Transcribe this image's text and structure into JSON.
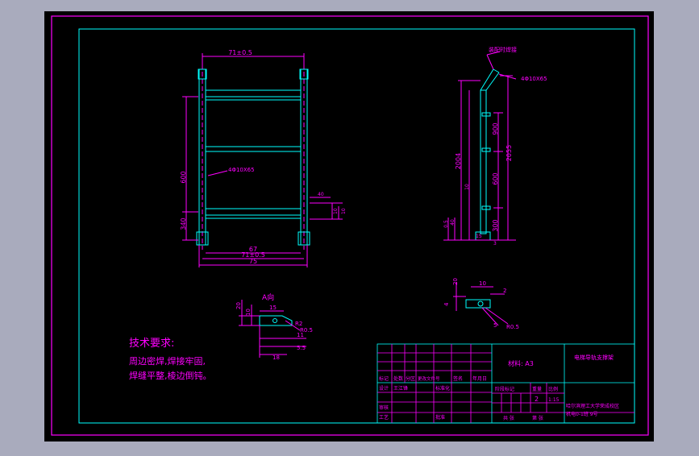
{
  "colors": {
    "chrome": "#a9abbd",
    "canvas": "#000000",
    "magenta": "#ff00ff",
    "cyan": "#00ffff",
    "white": "#ffffff",
    "green": "#00ff00"
  },
  "front_view": {
    "top_dim": "71±0.5",
    "height_dim": "600",
    "lower_dim": "340",
    "bottom_dim_1": "67",
    "bottom_dim_2": "71±0.5",
    "bottom_dim_3": "75",
    "hole_note": "4Φ10X65",
    "right_dims": [
      "40",
      "10",
      "10"
    ]
  },
  "side_view": {
    "callout": "装配时焊接",
    "hole_note": "4Φ10X65",
    "dims": [
      "2004",
      "2055",
      "900",
      "600",
      "300",
      "10",
      "40",
      "0.5",
      "15",
      "3"
    ]
  },
  "small_detail": {
    "dims": [
      "20",
      "10",
      "2",
      "4"
    ],
    "notes": [
      "5",
      "R0.5"
    ]
  },
  "view_a": {
    "title": "A向",
    "dims": [
      "15",
      "20",
      "10",
      "R2",
      "R0.5",
      "11",
      "5.5",
      "18"
    ]
  },
  "tech_notes": {
    "title": "技术要求:",
    "line1": "周边密焊,焊接牢固,",
    "line2": "焊缝平整,棱边倒钝。"
  },
  "title_block": {
    "material": "材料: A3",
    "part_name": "电梯导轨支撑架",
    "headers": [
      "标记",
      "处数",
      "分区",
      "更改文件号",
      "签名",
      "年月日"
    ],
    "row_labels": [
      "设计",
      "审核",
      "工艺"
    ],
    "designer": "王江锋",
    "standardization": "标准化",
    "approve": "批准",
    "stage": "阶段标记",
    "weight": "重量",
    "scale": "比例",
    "scale_value": "2",
    "ratio": "1:15",
    "sheet_total": "共 张",
    "sheet_no": "第 张",
    "company_line1": "哈尔滨理工大学荣成校区",
    "company_line2": "机电0-1班 9号"
  }
}
